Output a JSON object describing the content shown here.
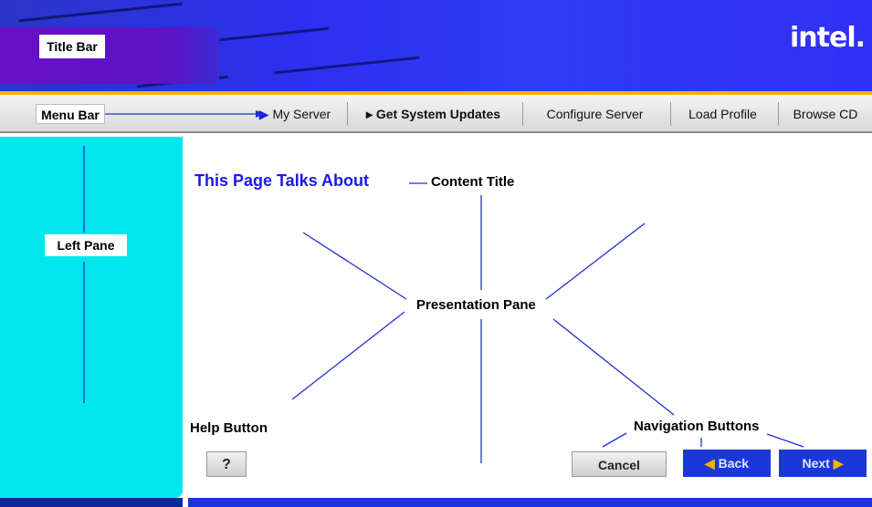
{
  "title_bar": {
    "label": "Title Bar",
    "logo": "intel."
  },
  "menu_bar": {
    "label": "Menu Bar",
    "items": [
      {
        "label": "My Server",
        "marker": "arrow-right-icon"
      },
      {
        "label": "▸ Get System Updates"
      },
      {
        "label": "Configure Server"
      },
      {
        "label": "Load Profile"
      },
      {
        "label": "Browse CD"
      }
    ]
  },
  "left_pane": {
    "label": "Left Pane"
  },
  "content": {
    "title": "This Page Talks About",
    "callouts": {
      "content_title": "Content Title",
      "presentation_pane": "Presentation Pane",
      "help_button": "Help Button",
      "navigation_buttons": "Navigation Buttons"
    }
  },
  "buttons": {
    "help": "?",
    "cancel": "Cancel",
    "back": "Back",
    "next": "Next"
  },
  "colors": {
    "title_bar_blue": "#2f3df3",
    "title_block_purple": "#5a14c4",
    "gold_line": "#f0b400",
    "left_pane_cyan": "#00e8ee",
    "content_title_blue": "#1a1ae6",
    "nav_button_blue": "#1c37d8",
    "connector_line": "#2030d0"
  }
}
